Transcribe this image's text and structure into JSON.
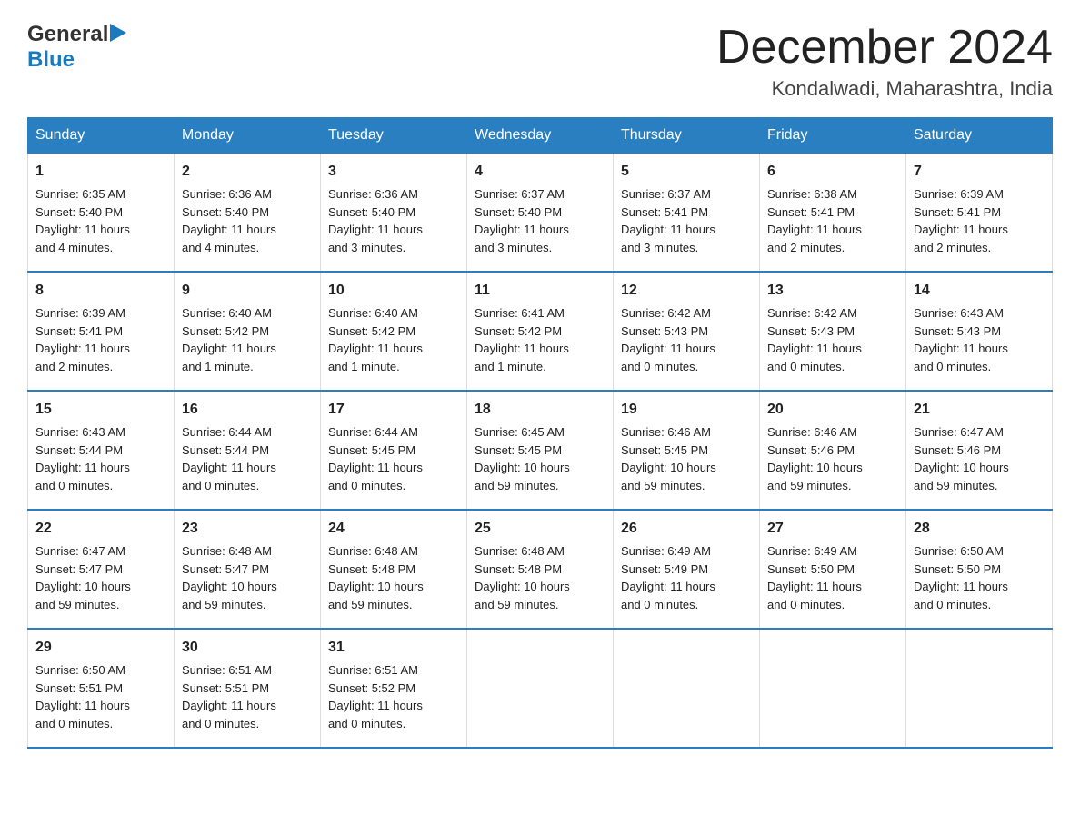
{
  "logo": {
    "general": "General",
    "blue": "Blue"
  },
  "title": "December 2024",
  "subtitle": "Kondalwadi, Maharashtra, India",
  "days": [
    "Sunday",
    "Monday",
    "Tuesday",
    "Wednesday",
    "Thursday",
    "Friday",
    "Saturday"
  ],
  "weeks": [
    [
      {
        "day": "1",
        "sunrise": "6:35 AM",
        "sunset": "5:40 PM",
        "daylight": "11 hours and 4 minutes."
      },
      {
        "day": "2",
        "sunrise": "6:36 AM",
        "sunset": "5:40 PM",
        "daylight": "11 hours and 4 minutes."
      },
      {
        "day": "3",
        "sunrise": "6:36 AM",
        "sunset": "5:40 PM",
        "daylight": "11 hours and 3 minutes."
      },
      {
        "day": "4",
        "sunrise": "6:37 AM",
        "sunset": "5:40 PM",
        "daylight": "11 hours and 3 minutes."
      },
      {
        "day": "5",
        "sunrise": "6:37 AM",
        "sunset": "5:41 PM",
        "daylight": "11 hours and 3 minutes."
      },
      {
        "day": "6",
        "sunrise": "6:38 AM",
        "sunset": "5:41 PM",
        "daylight": "11 hours and 2 minutes."
      },
      {
        "day": "7",
        "sunrise": "6:39 AM",
        "sunset": "5:41 PM",
        "daylight": "11 hours and 2 minutes."
      }
    ],
    [
      {
        "day": "8",
        "sunrise": "6:39 AM",
        "sunset": "5:41 PM",
        "daylight": "11 hours and 2 minutes."
      },
      {
        "day": "9",
        "sunrise": "6:40 AM",
        "sunset": "5:42 PM",
        "daylight": "11 hours and 1 minute."
      },
      {
        "day": "10",
        "sunrise": "6:40 AM",
        "sunset": "5:42 PM",
        "daylight": "11 hours and 1 minute."
      },
      {
        "day": "11",
        "sunrise": "6:41 AM",
        "sunset": "5:42 PM",
        "daylight": "11 hours and 1 minute."
      },
      {
        "day": "12",
        "sunrise": "6:42 AM",
        "sunset": "5:43 PM",
        "daylight": "11 hours and 0 minutes."
      },
      {
        "day": "13",
        "sunrise": "6:42 AM",
        "sunset": "5:43 PM",
        "daylight": "11 hours and 0 minutes."
      },
      {
        "day": "14",
        "sunrise": "6:43 AM",
        "sunset": "5:43 PM",
        "daylight": "11 hours and 0 minutes."
      }
    ],
    [
      {
        "day": "15",
        "sunrise": "6:43 AM",
        "sunset": "5:44 PM",
        "daylight": "11 hours and 0 minutes."
      },
      {
        "day": "16",
        "sunrise": "6:44 AM",
        "sunset": "5:44 PM",
        "daylight": "11 hours and 0 minutes."
      },
      {
        "day": "17",
        "sunrise": "6:44 AM",
        "sunset": "5:45 PM",
        "daylight": "11 hours and 0 minutes."
      },
      {
        "day": "18",
        "sunrise": "6:45 AM",
        "sunset": "5:45 PM",
        "daylight": "10 hours and 59 minutes."
      },
      {
        "day": "19",
        "sunrise": "6:46 AM",
        "sunset": "5:45 PM",
        "daylight": "10 hours and 59 minutes."
      },
      {
        "day": "20",
        "sunrise": "6:46 AM",
        "sunset": "5:46 PM",
        "daylight": "10 hours and 59 minutes."
      },
      {
        "day": "21",
        "sunrise": "6:47 AM",
        "sunset": "5:46 PM",
        "daylight": "10 hours and 59 minutes."
      }
    ],
    [
      {
        "day": "22",
        "sunrise": "6:47 AM",
        "sunset": "5:47 PM",
        "daylight": "10 hours and 59 minutes."
      },
      {
        "day": "23",
        "sunrise": "6:48 AM",
        "sunset": "5:47 PM",
        "daylight": "10 hours and 59 minutes."
      },
      {
        "day": "24",
        "sunrise": "6:48 AM",
        "sunset": "5:48 PM",
        "daylight": "10 hours and 59 minutes."
      },
      {
        "day": "25",
        "sunrise": "6:48 AM",
        "sunset": "5:48 PM",
        "daylight": "10 hours and 59 minutes."
      },
      {
        "day": "26",
        "sunrise": "6:49 AM",
        "sunset": "5:49 PM",
        "daylight": "11 hours and 0 minutes."
      },
      {
        "day": "27",
        "sunrise": "6:49 AM",
        "sunset": "5:50 PM",
        "daylight": "11 hours and 0 minutes."
      },
      {
        "day": "28",
        "sunrise": "6:50 AM",
        "sunset": "5:50 PM",
        "daylight": "11 hours and 0 minutes."
      }
    ],
    [
      {
        "day": "29",
        "sunrise": "6:50 AM",
        "sunset": "5:51 PM",
        "daylight": "11 hours and 0 minutes."
      },
      {
        "day": "30",
        "sunrise": "6:51 AM",
        "sunset": "5:51 PM",
        "daylight": "11 hours and 0 minutes."
      },
      {
        "day": "31",
        "sunrise": "6:51 AM",
        "sunset": "5:52 PM",
        "daylight": "11 hours and 0 minutes."
      },
      null,
      null,
      null,
      null
    ]
  ],
  "labels": {
    "sunrise": "Sunrise:",
    "sunset": "Sunset:",
    "daylight": "Daylight:"
  }
}
